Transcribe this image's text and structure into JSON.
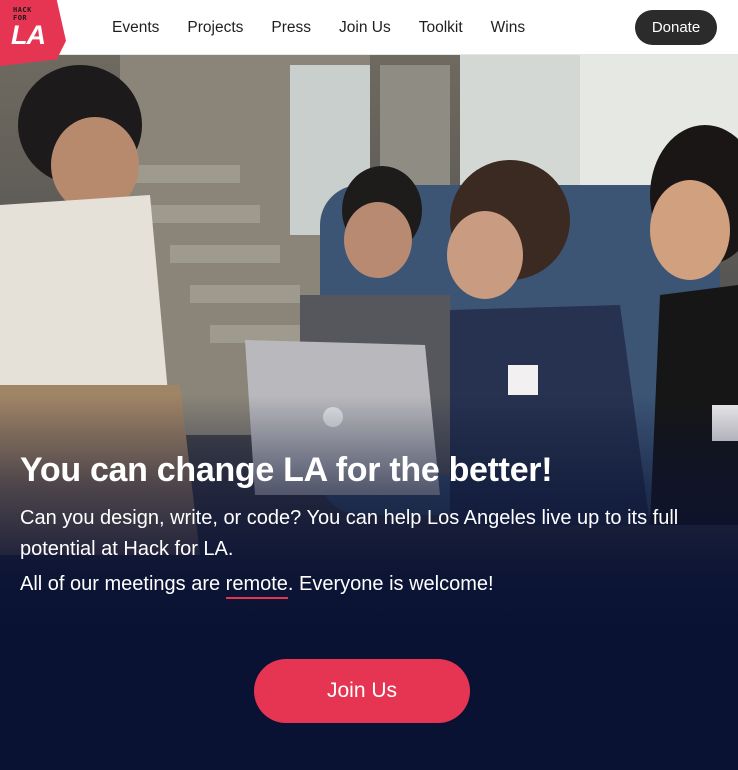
{
  "brand": {
    "logo_line1": "HACK",
    "logo_line2": "FOR",
    "logo_big": "LA",
    "accent": "#e63553",
    "navy": "#0a1234"
  },
  "nav": {
    "items": [
      {
        "label": "Events"
      },
      {
        "label": "Projects"
      },
      {
        "label": "Press"
      },
      {
        "label": "Join Us"
      },
      {
        "label": "Toolkit"
      },
      {
        "label": "Wins"
      }
    ],
    "donate_label": "Donate"
  },
  "hero": {
    "headline": "You can change LA for the better!",
    "subtext": "Can you design, write, or code? You can help Los Angeles live up to its full potential at Hack for LA.",
    "meetings_before": "All of our meetings are ",
    "meetings_link": "remote",
    "meetings_after": ". Everyone is welcome!",
    "cta_label": "Join Us"
  }
}
